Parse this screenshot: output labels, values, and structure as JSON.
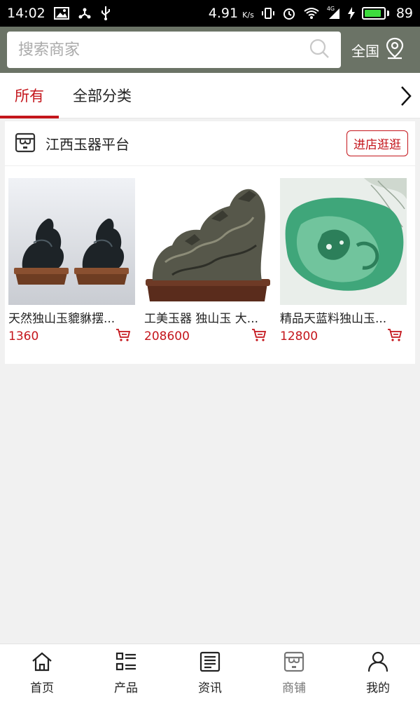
{
  "status_bar": {
    "time": "14:02",
    "speed": "4.91",
    "speed_unit": "K/s",
    "network_label": "4G",
    "battery_level": 89,
    "battery_text": "89"
  },
  "search": {
    "placeholder": "搜索商家",
    "region_label": "全国"
  },
  "tabs": [
    {
      "label": "所有",
      "active": true
    },
    {
      "label": "全部分类",
      "active": false
    }
  ],
  "store": {
    "name": "江西玉器平台",
    "visit_label": "进店逛逛",
    "products": [
      {
        "title": "天然独山玉貔貅摆...",
        "price": "1360",
        "image": "black-jade-pixiu-pair"
      },
      {
        "title": "工美玉器 独山玉 大...",
        "price": "208600",
        "image": "jade-horses-carving"
      },
      {
        "title": "精品天蓝料独山玉...",
        "price": "12800",
        "image": "green-jade-pendant"
      }
    ]
  },
  "bottom_nav": [
    {
      "label": "首页",
      "icon": "home-icon",
      "active": false
    },
    {
      "label": "产品",
      "icon": "list-icon",
      "active": false
    },
    {
      "label": "资讯",
      "icon": "news-icon",
      "active": false
    },
    {
      "label": "商铺",
      "icon": "store-icon",
      "active": true
    },
    {
      "label": "我的",
      "icon": "user-icon",
      "active": false
    }
  ],
  "colors": {
    "accent": "#c4161c",
    "header_bg": "#6b7366",
    "page_bg": "#f1f1f1"
  }
}
